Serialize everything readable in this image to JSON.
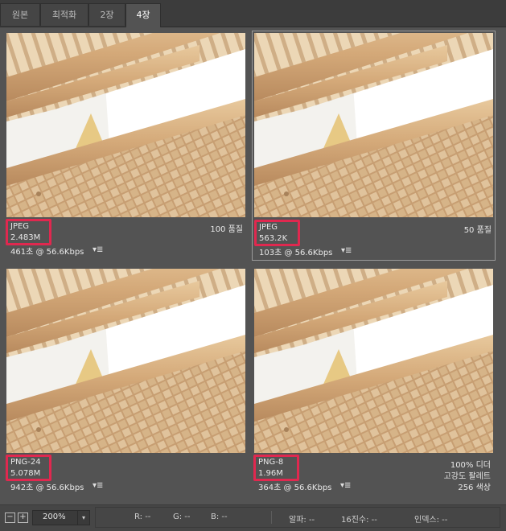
{
  "tabs": [
    {
      "label": "원본"
    },
    {
      "label": "최적화"
    },
    {
      "label": "2장"
    },
    {
      "label": "4장"
    }
  ],
  "panels": [
    {
      "format": "JPEG",
      "size": "2.483M",
      "time": "461초 @ 56.6Kbps",
      "menu_icon": "▾≣",
      "q1": "100 품질",
      "q2": "",
      "q3": ""
    },
    {
      "format": "JPEG",
      "size": "563.2K",
      "time": "103초 @ 56.6Kbps",
      "menu_icon": "▾≣",
      "q1": "50 품질",
      "q2": "",
      "q3": ""
    },
    {
      "format": "PNG-24",
      "size": "5.078M",
      "time": "942초 @ 56.6Kbps",
      "menu_icon": "▾≣",
      "q1": "",
      "q2": "",
      "q3": ""
    },
    {
      "format": "PNG-8",
      "size": "1.96M",
      "time": "364초 @ 56.6Kbps",
      "menu_icon": "▾≣",
      "q1": "100% 디더",
      "q2": "고강도 팔레트",
      "q3": "256 색상"
    }
  ],
  "status": {
    "zoom_out": "−",
    "zoom_in": "+",
    "zoom": "200%",
    "dropdown": "▾",
    "r": "R: --",
    "g": "G: --",
    "b": "B: --",
    "alpha": "알파: --",
    "hex": "16진수: --",
    "index": "인덱스: --"
  }
}
